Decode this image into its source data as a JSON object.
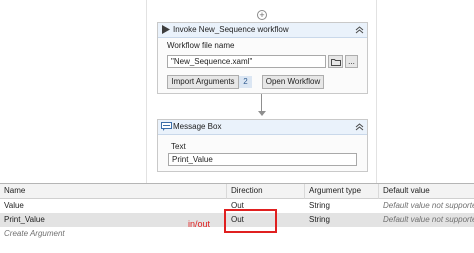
{
  "sequence1": {
    "title": "Invoke New_Sequence workflow",
    "file_label": "Workflow file name",
    "file_value": "\"New_Sequence.xaml\"",
    "browse_dots": "...",
    "import_label": "Import Arguments",
    "import_count": "2",
    "open_label": "Open Workflow"
  },
  "message_box": {
    "title": "Message Box",
    "text_label": "Text",
    "text_value": "Print_Value"
  },
  "grid": {
    "headers": [
      "Name",
      "Direction",
      "Argument type",
      "Default value"
    ],
    "rows": [
      {
        "name": "Value",
        "direction": "Out",
        "type": "String",
        "default": "Default value not supported"
      },
      {
        "name": "Print_Value",
        "direction": "Out",
        "type": "String",
        "default": "Default value not supported"
      }
    ],
    "create_label": "Create Argument"
  },
  "annotation": {
    "text": "in/out",
    "color": "#e02020"
  }
}
